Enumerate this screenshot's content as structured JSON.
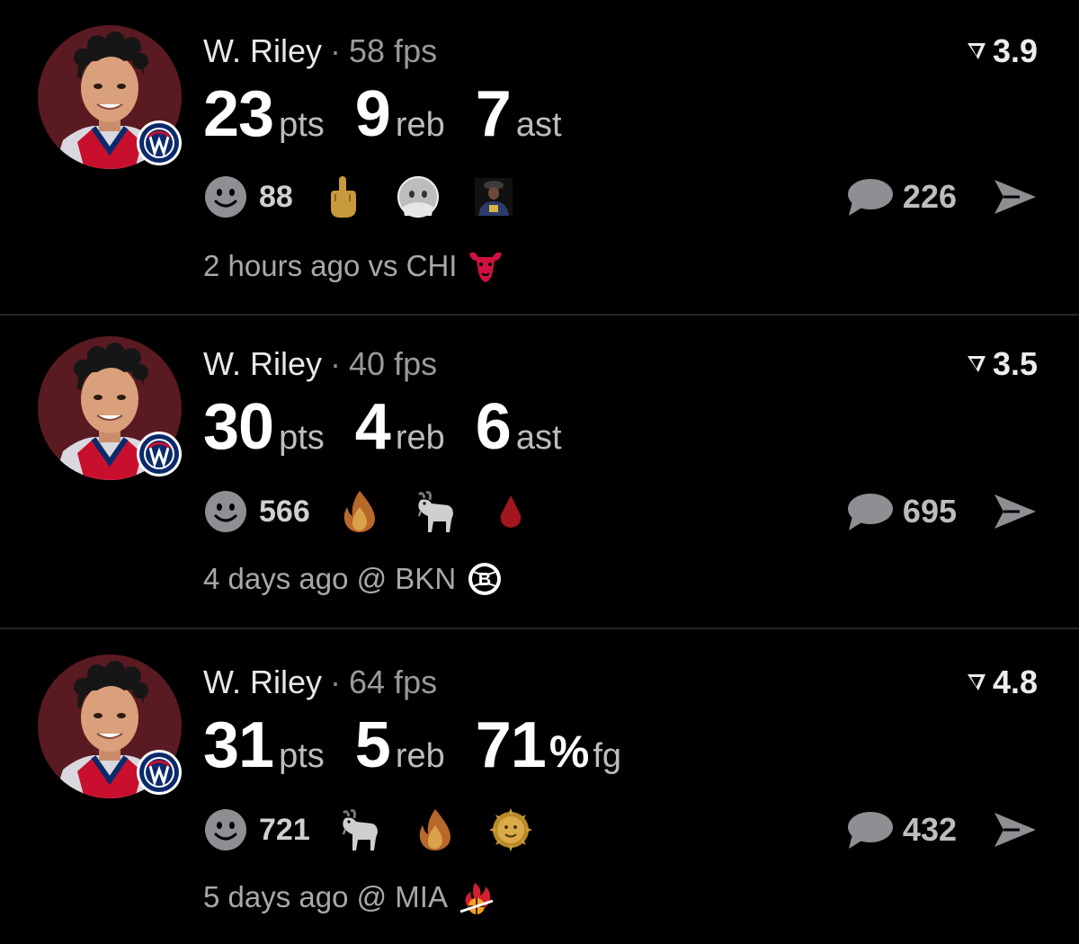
{
  "cards": [
    {
      "player": "W. Riley",
      "fps": "58 fps",
      "rating": "3.9",
      "stats": [
        {
          "num": "23",
          "unit": "pts"
        },
        {
          "num": "9",
          "unit": "reb"
        },
        {
          "num": "7",
          "unit": "ast"
        }
      ],
      "reactions_count": "88",
      "reaction_icons": [
        "middle-finger-icon",
        "face-covering-icon",
        "person-photo-icon"
      ],
      "comments": "226",
      "footer": "2 hours ago vs CHI",
      "opponent_logo": "bulls-logo"
    },
    {
      "player": "W. Riley",
      "fps": "40 fps",
      "rating": "3.5",
      "stats": [
        {
          "num": "30",
          "unit": "pts"
        },
        {
          "num": "4",
          "unit": "reb"
        },
        {
          "num": "6",
          "unit": "ast"
        }
      ],
      "reactions_count": "566",
      "reaction_icons": [
        "fire-icon",
        "goat-icon",
        "drop-of-blood-icon"
      ],
      "comments": "695",
      "footer": "4 days ago @ BKN",
      "opponent_logo": "nets-logo"
    },
    {
      "player": "W. Riley",
      "fps": "64 fps",
      "rating": "4.8",
      "stats": [
        {
          "num": "31",
          "unit": "pts"
        },
        {
          "num": "5",
          "unit": "reb"
        },
        {
          "num": "71",
          "pct": "%",
          "unit": "fg"
        }
      ],
      "reactions_count": "721",
      "reaction_icons": [
        "goat-icon",
        "fire-icon",
        "sun-face-icon"
      ],
      "comments": "432",
      "footer": "5 days ago @ MIA",
      "opponent_logo": "heat-logo"
    }
  ],
  "colors": {
    "background": "#000000",
    "divider": "#262626",
    "avatar_bg": "#5a1a22",
    "wizards_blue": "#0b2a6b",
    "wizards_red": "#c8102e"
  }
}
